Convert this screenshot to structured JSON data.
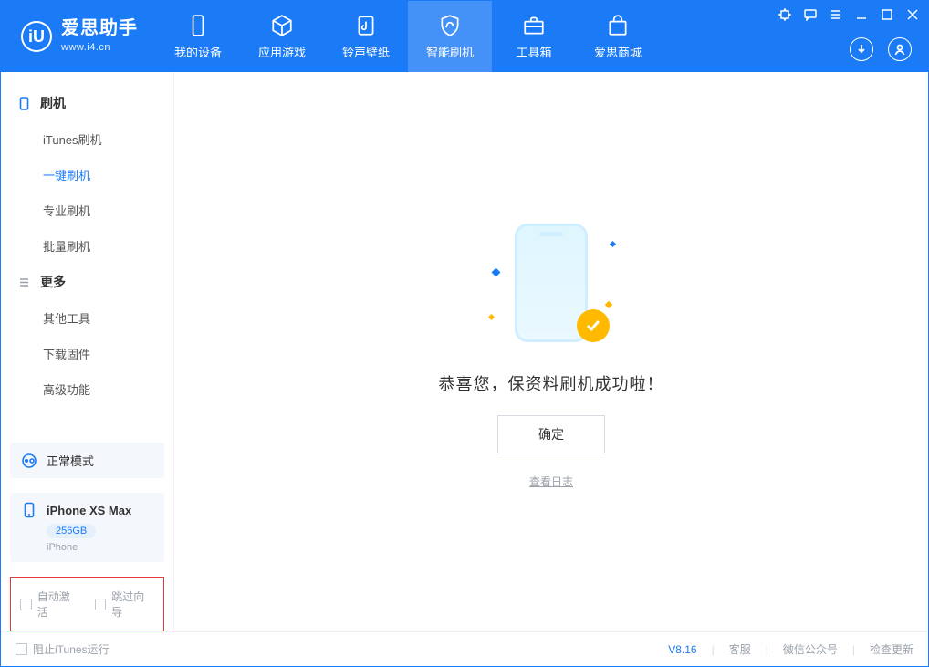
{
  "app": {
    "name": "爱思助手",
    "domain": "www.i4.cn"
  },
  "nav": {
    "items": [
      {
        "label": "我的设备"
      },
      {
        "label": "应用游戏"
      },
      {
        "label": "铃声壁纸"
      },
      {
        "label": "智能刷机"
      },
      {
        "label": "工具箱"
      },
      {
        "label": "爱思商城"
      }
    ],
    "activeIndex": 3
  },
  "sidebar": {
    "group1": {
      "title": "刷机",
      "items": [
        {
          "label": "iTunes刷机"
        },
        {
          "label": "一键刷机"
        },
        {
          "label": "专业刷机"
        },
        {
          "label": "批量刷机"
        }
      ],
      "activeIndex": 1
    },
    "group2": {
      "title": "更多",
      "items": [
        {
          "label": "其他工具"
        },
        {
          "label": "下载固件"
        },
        {
          "label": "高级功能"
        }
      ]
    },
    "modeCard": {
      "label": "正常模式"
    },
    "deviceCard": {
      "name": "iPhone XS Max",
      "storage": "256GB",
      "type": "iPhone"
    },
    "options": {
      "opt1": "自动激活",
      "opt2": "跳过向导"
    }
  },
  "main": {
    "message": "恭喜您，保资料刷机成功啦！",
    "ok": "确定",
    "logLink": "查看日志"
  },
  "footer": {
    "blockItunes": "阻止iTunes运行",
    "version": "V8.16",
    "links": [
      "客服",
      "微信公众号",
      "检查更新"
    ]
  }
}
